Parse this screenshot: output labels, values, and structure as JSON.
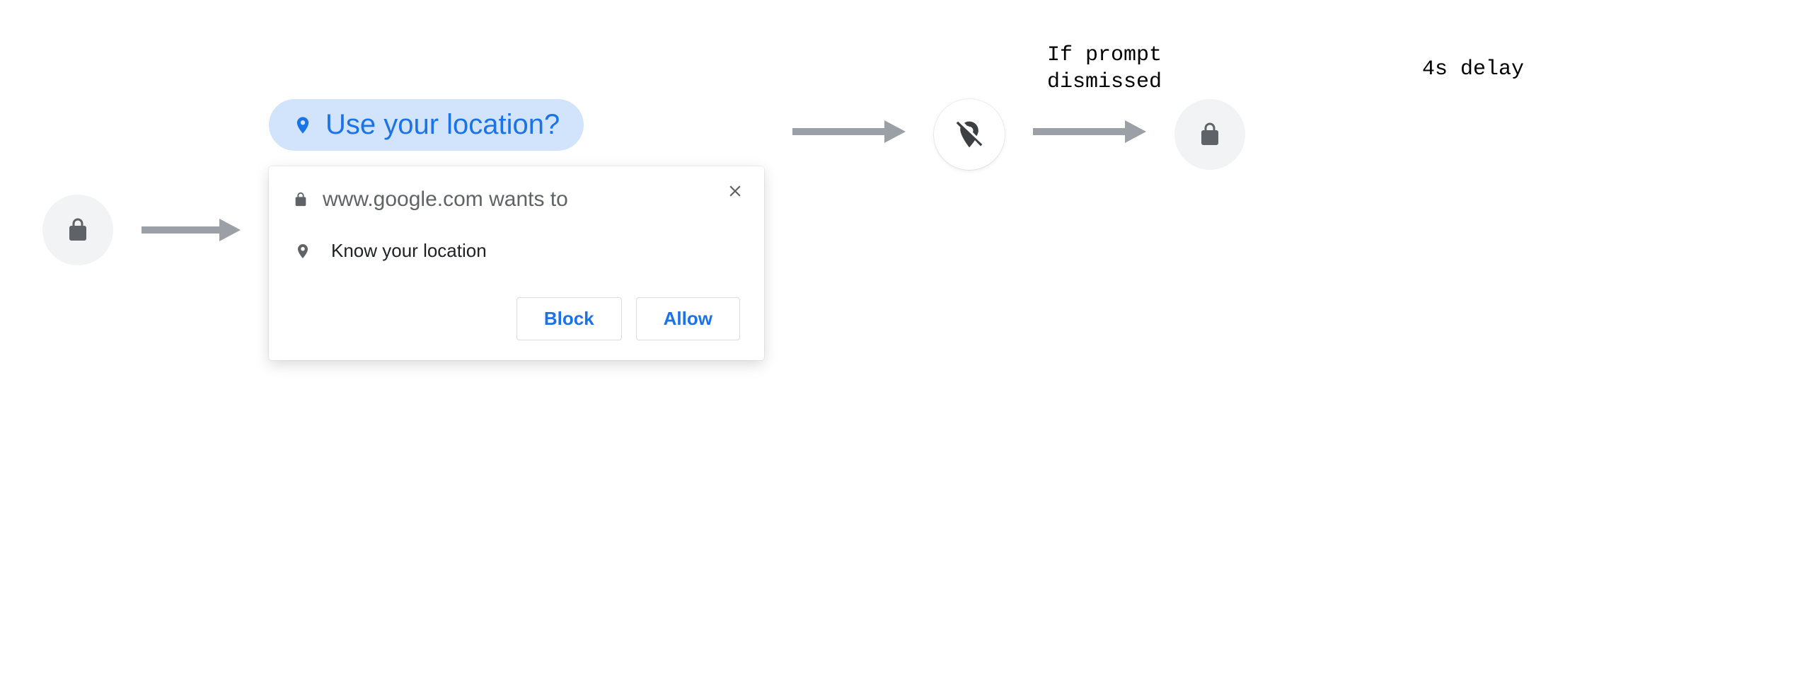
{
  "chip": {
    "label": "Use your location?"
  },
  "captions": {
    "dismissed": "If prompt\ndismissed",
    "delay": "4s delay"
  },
  "dialog": {
    "title": "www.google.com wants to",
    "permission": "Know your location",
    "block": "Block",
    "allow": "Allow"
  }
}
